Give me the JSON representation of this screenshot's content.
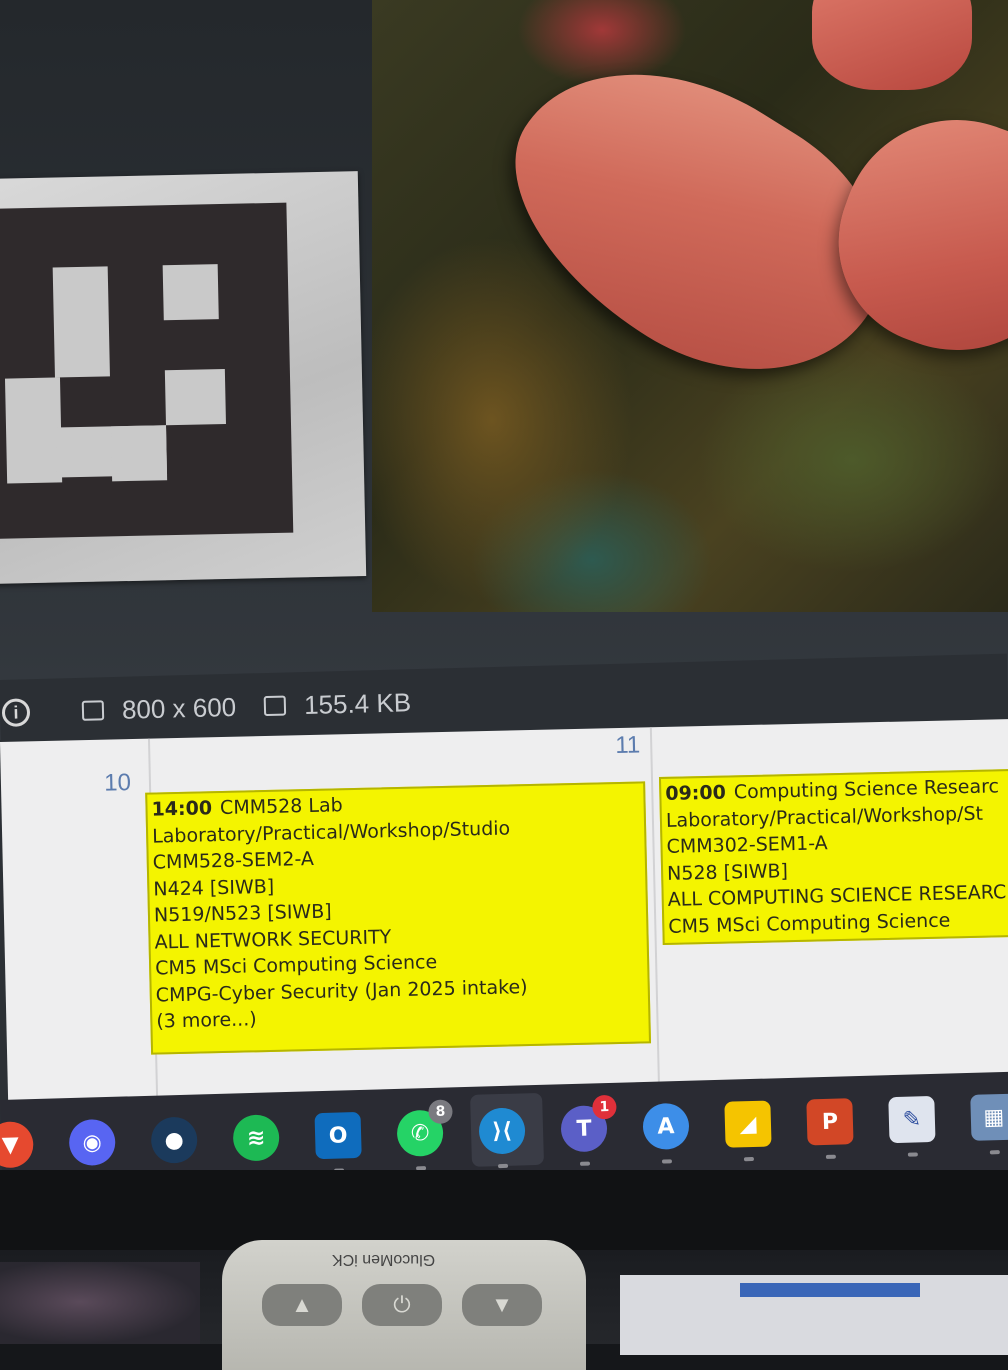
{
  "status_bar": {
    "dimensions": "800 x 600",
    "file_size": "155.4 KB"
  },
  "calendar": {
    "days": [
      {
        "number": "10",
        "events": []
      },
      {
        "number": "11",
        "events": [
          {
            "time": "14:00",
            "title": "CMM528 Lab",
            "lines": [
              "Laboratory/Practical/Workshop/Studio",
              "CMM528-SEM2-A",
              "N424 [SIWB]",
              "N519/N523 [SIWB]",
              "ALL NETWORK SECURITY",
              "CM5 MSci Computing Science",
              "CMPG-Cyber Security (Jan 2025 intake)",
              "(3 more...)"
            ],
            "color": "#f4f400"
          }
        ]
      },
      {
        "number": "",
        "events": [
          {
            "time": "09:00",
            "title": "Computing Science Researc",
            "lines": [
              "Laboratory/Practical/Workshop/St",
              "CMM302-SEM1-A",
              "N528 [SIWB]",
              "ALL COMPUTING SCIENCE RESEARC",
              "CM5 MSci Computing Science"
            ],
            "color": "#f4f400"
          }
        ]
      }
    ]
  },
  "taskbar": {
    "icons": [
      {
        "name": "brave-icon",
        "glyph": "▼",
        "color": "#e6492f"
      },
      {
        "name": "discord-icon",
        "glyph": "◉",
        "color": "#5865f2"
      },
      {
        "name": "steam-icon",
        "glyph": "●",
        "color": "#1b3a5c"
      },
      {
        "name": "spotify-icon",
        "glyph": "≋",
        "color": "#1db954"
      },
      {
        "name": "outlook-icon",
        "glyph": "O",
        "color": "#0f6cbd"
      },
      {
        "name": "whatsapp-icon",
        "glyph": "✆",
        "color": "#25d366",
        "badge": "8"
      },
      {
        "name": "vscode-icon",
        "glyph": "⟩⟨",
        "color": "#1f8ad2"
      },
      {
        "name": "teams-icon",
        "glyph": "T",
        "color": "#5b5fc7",
        "badge": "1"
      },
      {
        "name": "app-store-icon",
        "glyph": "A",
        "color": "#3d8ee8"
      },
      {
        "name": "sticky-notes-icon",
        "glyph": "◢",
        "color": "#f5c400"
      },
      {
        "name": "powerpoint-icon",
        "glyph": "P",
        "color": "#d24726"
      },
      {
        "name": "snipping-tool-icon",
        "glyph": "✎",
        "color": "#dfe4ee"
      },
      {
        "name": "calculator-icon",
        "glyph": "▦",
        "color": "#6f8fb8"
      }
    ]
  },
  "remote": {
    "brand": "GlucoMen iCK"
  }
}
